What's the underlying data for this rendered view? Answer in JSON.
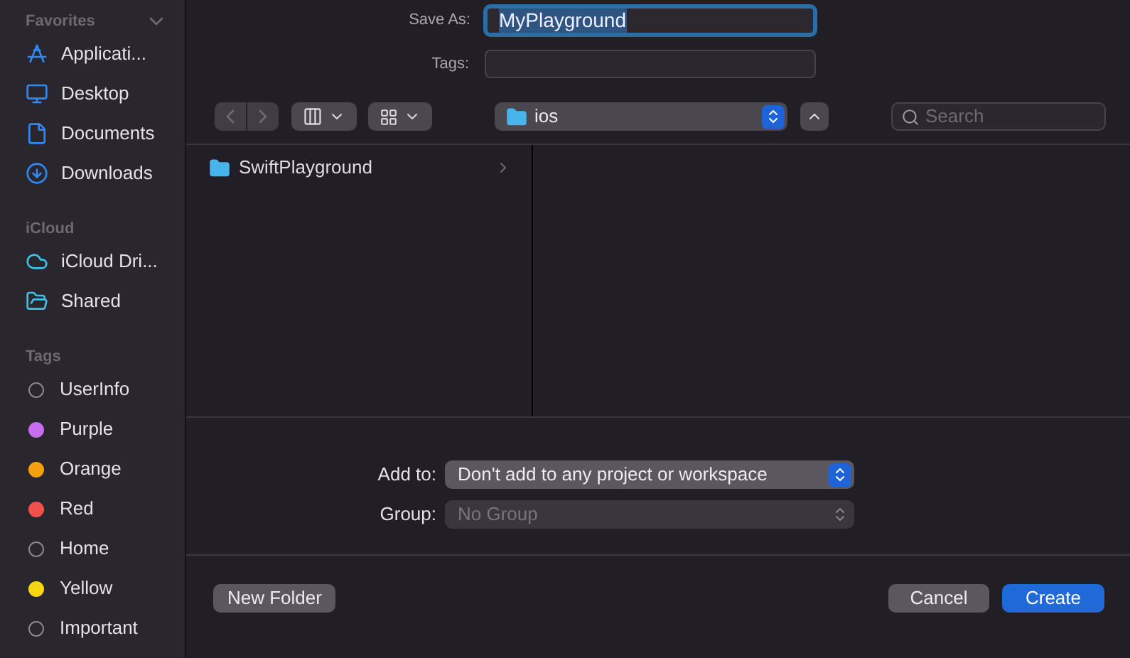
{
  "sidebar": {
    "sections": [
      {
        "title": "Favorites",
        "expanded": true,
        "items": [
          {
            "label": "Applicati..."
          },
          {
            "label": "Desktop"
          },
          {
            "label": "Documents"
          },
          {
            "label": "Downloads"
          }
        ]
      },
      {
        "title": "iCloud",
        "items": [
          {
            "label": "iCloud Dri..."
          },
          {
            "label": "Shared"
          }
        ]
      },
      {
        "title": "Tags",
        "items": [
          {
            "label": "UserInfo"
          },
          {
            "label": "Purple",
            "color": "#c86cf0"
          },
          {
            "label": "Orange",
            "color": "#f5a00f"
          },
          {
            "label": "Red",
            "color": "#f0514a"
          },
          {
            "label": "Home"
          },
          {
            "label": "Yellow",
            "color": "#f7d70f"
          },
          {
            "label": "Important"
          }
        ]
      }
    ]
  },
  "save_as": {
    "label": "Save As:",
    "value": "MyPlayground"
  },
  "tags_field": {
    "label": "Tags:"
  },
  "location": {
    "value": "ios"
  },
  "search": {
    "placeholder": "Search"
  },
  "browser": {
    "items": [
      {
        "label": "SwiftPlayground",
        "selected": false
      }
    ]
  },
  "add_to": {
    "label": "Add to:",
    "value": "Don't add to any project or workspace",
    "disabled": false
  },
  "group": {
    "label": "Group:",
    "value": "No Group",
    "disabled": true
  },
  "buttons": {
    "new_folder": "New Folder",
    "cancel": "Cancel",
    "create": "Create"
  }
}
